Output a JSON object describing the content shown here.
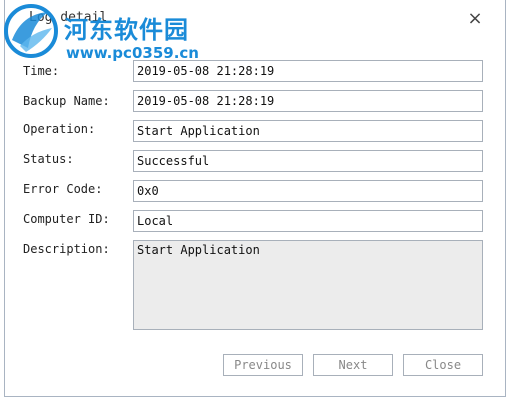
{
  "dialog": {
    "title": "Log detail",
    "close_glyph": "×"
  },
  "watermark": {
    "site_name": "河东软件园",
    "site_url": "www.pc0359.cn"
  },
  "fields": {
    "time": {
      "label": "Time:",
      "value": "2019-05-08 21:28:19"
    },
    "backup_name": {
      "label": "Backup Name:",
      "value": "2019-05-08 21:28:19"
    },
    "operation": {
      "label": "Operation:",
      "value": "Start Application"
    },
    "status": {
      "label": "Status:",
      "value": "Successful"
    },
    "error_code": {
      "label": "Error Code:",
      "value": "0x0"
    },
    "computer_id": {
      "label": "Computer ID:",
      "value": "Local"
    },
    "description": {
      "label": "Description:",
      "value": "Start Application"
    }
  },
  "buttons": {
    "previous": "Previous",
    "next": "Next",
    "close": "Close"
  },
  "colors": {
    "watermark_blue": "#1a8bd8",
    "border": "#a8b0ba",
    "disabled_text": "#888888"
  }
}
